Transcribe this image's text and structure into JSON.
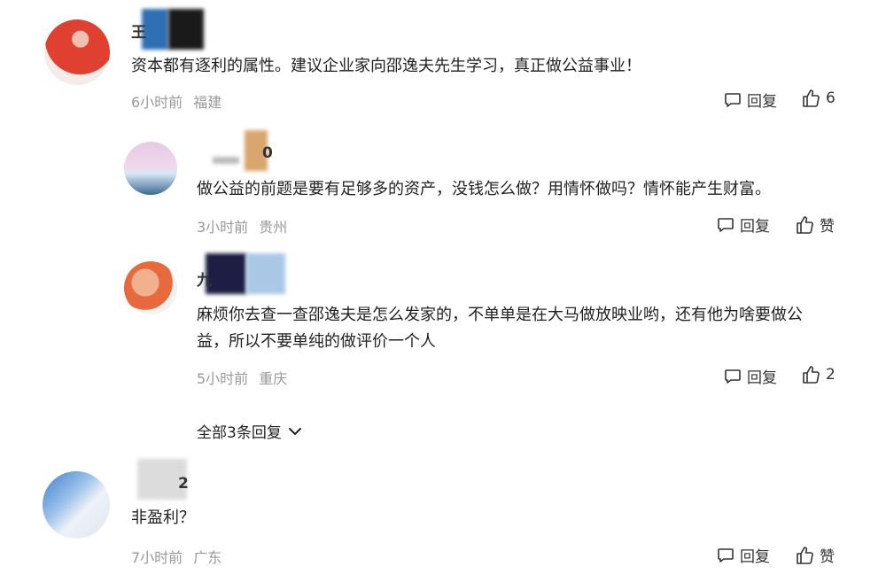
{
  "comments": [
    {
      "name": "王",
      "text": "资本都有逐利的属性。建议企业家向邵逸夫先生学习，真正做公益事业！",
      "time": "6小时前",
      "location": "福建",
      "reply_label": "回复",
      "like_label": "6"
    },
    {
      "name": "0",
      "text": "做公益的前题是要有足够多的资产，没钱怎么做？用情怀做吗？情怀能产生财富。",
      "time": "3小时前",
      "location": "贵州",
      "reply_label": "回复",
      "like_label": "赞"
    },
    {
      "name": "九",
      "text_lines": [
        "麻烦你去查一查邵逸夫是怎么发家的，不单单是在大马做放映业哟，还有他为啥要做公",
        "益，所以不要单纯的做评价一个人"
      ],
      "time": "5小时前",
      "location": "重庆",
      "reply_label": "回复",
      "like_label": "2"
    },
    {
      "name": "2",
      "text": "非盈利？",
      "time": "7小时前",
      "location": "广东",
      "reply_label": "回复",
      "like_label": "赞"
    }
  ],
  "all_replies": {
    "label": "全部3条回复"
  },
  "icons": {
    "reply": "comment-bubble-icon",
    "like": "thumbs-up-icon",
    "expand": "chevron-down-icon"
  }
}
